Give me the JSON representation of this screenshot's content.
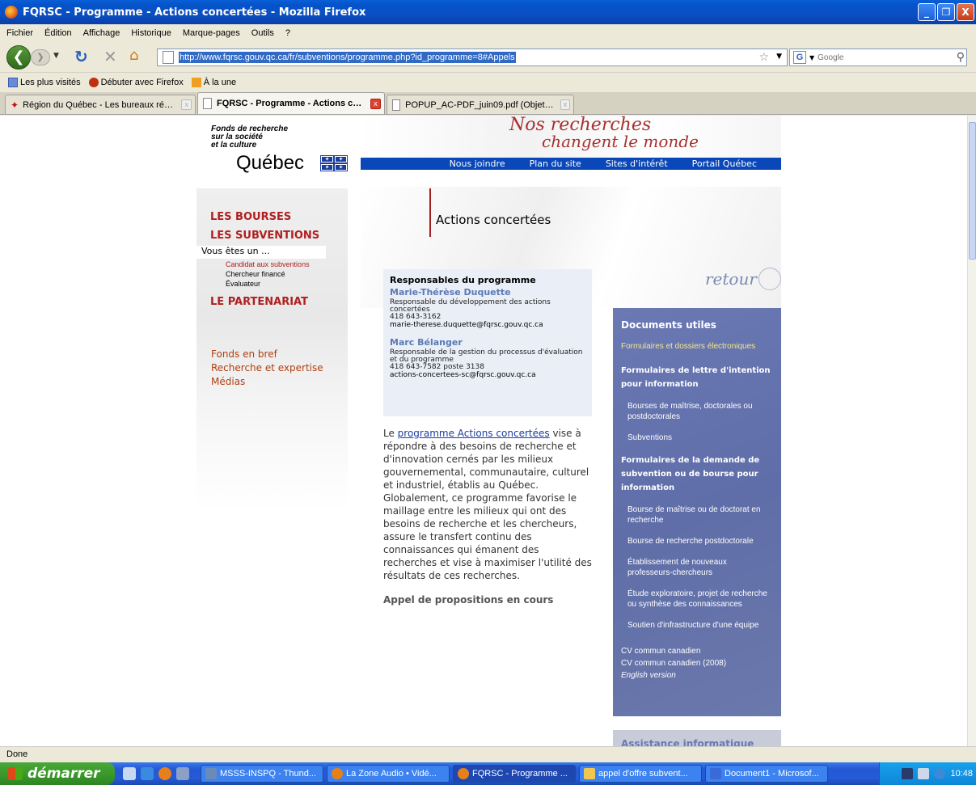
{
  "window": {
    "title": "FQRSC - Programme - Actions concertées - Mozilla Firefox",
    "buttons": [
      "_",
      "❐",
      "X"
    ]
  },
  "menu": [
    "Fichier",
    "Édition",
    "Affichage",
    "Historique",
    "Marque-pages",
    "Outils",
    "?"
  ],
  "navbar": {
    "url": "http://www.fqrsc.gouv.qc.ca/fr/subventions/programme.php?id_programme=8#Appels",
    "search_placeholder": "Google"
  },
  "bookmarks": [
    "Les plus visités",
    "Débuter avec Firefox",
    "À la une"
  ],
  "tabs": [
    {
      "label": "Région du Québec - Les bureaux régio...",
      "active": false
    },
    {
      "label": "FQRSC - Programme - Actions co...",
      "active": true
    },
    {
      "label": "POPUP_AC-PDF_juin09.pdf (Objet appl...",
      "active": false
    }
  ],
  "site": {
    "logo_lines": [
      "Fonds de recherche",
      "sur la société",
      "et la culture"
    ],
    "logo_quebec": "Québec",
    "slogan_line1": "Nos recherches",
    "slogan_line2": "changent le monde",
    "topnav": [
      "Nous joindre",
      "Plan du site",
      "Sites d'intérêt",
      "Portail Québec"
    ]
  },
  "sidebar": {
    "bourses": "LES BOURSES",
    "subventions": "LES SUBVENTIONS",
    "vous": "Vous êtes un ...",
    "subitems": [
      "Candidat aux subventions",
      "Chercheur financé",
      "Évaluateur"
    ],
    "partenariat": "LE PARTENARIAT",
    "links": [
      "Fonds en bref",
      "Recherche et expertise",
      "Médias"
    ]
  },
  "main": {
    "title": "Actions concertées",
    "responsables": {
      "heading": "Responsables du programme",
      "people": [
        {
          "name": "Marie-Thérèse Duquette",
          "role": "Responsable du développement des actions concertées",
          "phone": "418 643-3162",
          "email": "marie-therese.duquette@fqrsc.gouv.qc.ca"
        },
        {
          "name": "Marc Bélanger",
          "role": "Responsable de la gestion du processus d'évaluation et du programme",
          "phone": "418 643-7582 poste 3138",
          "email": "actions-concertees-sc@fqrsc.gouv.qc.ca"
        }
      ]
    },
    "retour": "retour",
    "intro_before": "Le ",
    "intro_link": "programme Actions concertées",
    "intro_after": " vise à répondre à des besoins de recherche et d'innovation cernés par les milieux gouvernemental, communautaire, culturel et industriel, établis au Québec. Globalement, ce programme favorise le maillage entre les milieux qui ont des besoins de recherche et les chercheurs, assure le transfert continu des connaissances qui émanent des recherches et vise à maximiser l'utilité des résultats de ces recherches.",
    "appel": "Appel de propositions en cours"
  },
  "docs": {
    "heading": "Documents utiles",
    "formulaires": "Formulaires et dossiers électroniques",
    "section1": "Formulaires de lettre d'intention pour information",
    "items1": [
      "Bourses de maîtrise, doctorales ou postdoctorales",
      "Subventions"
    ],
    "section2": "Formulaires de la demande de subvention ou de bourse pour information",
    "items2": [
      "Bourse de maîtrise ou de doctorat en recherche",
      "Bourse de recherche postdoctorale",
      "Établissement de nouveaux professeurs-chercheurs",
      "Étude exploratoire, projet de recherche ou synthèse des connaissances",
      "Soutien d'infrastructure d'une équipe"
    ],
    "cv": [
      "CV commun canadien",
      "CV commun canadien (2008)"
    ],
    "english": "English version",
    "assistance": "Assistance informatique"
  },
  "status": "Done",
  "taskbar": {
    "start": "démarrer",
    "tasks": [
      {
        "label": "MSSS-INSPQ - Thund...",
        "color": "#6a8ab8",
        "active": false
      },
      {
        "label": "La Zone Audio • Vidé...",
        "color": "#e8801a",
        "active": false
      },
      {
        "label": "FQRSC - Programme ...",
        "color": "#e8801a",
        "active": true
      },
      {
        "label": "appel d'offre subvent...",
        "color": "#f0c850",
        "active": false
      },
      {
        "label": "Document1 - Microsof...",
        "color": "#3a6ad8",
        "active": false
      }
    ],
    "clock": "10:48"
  }
}
